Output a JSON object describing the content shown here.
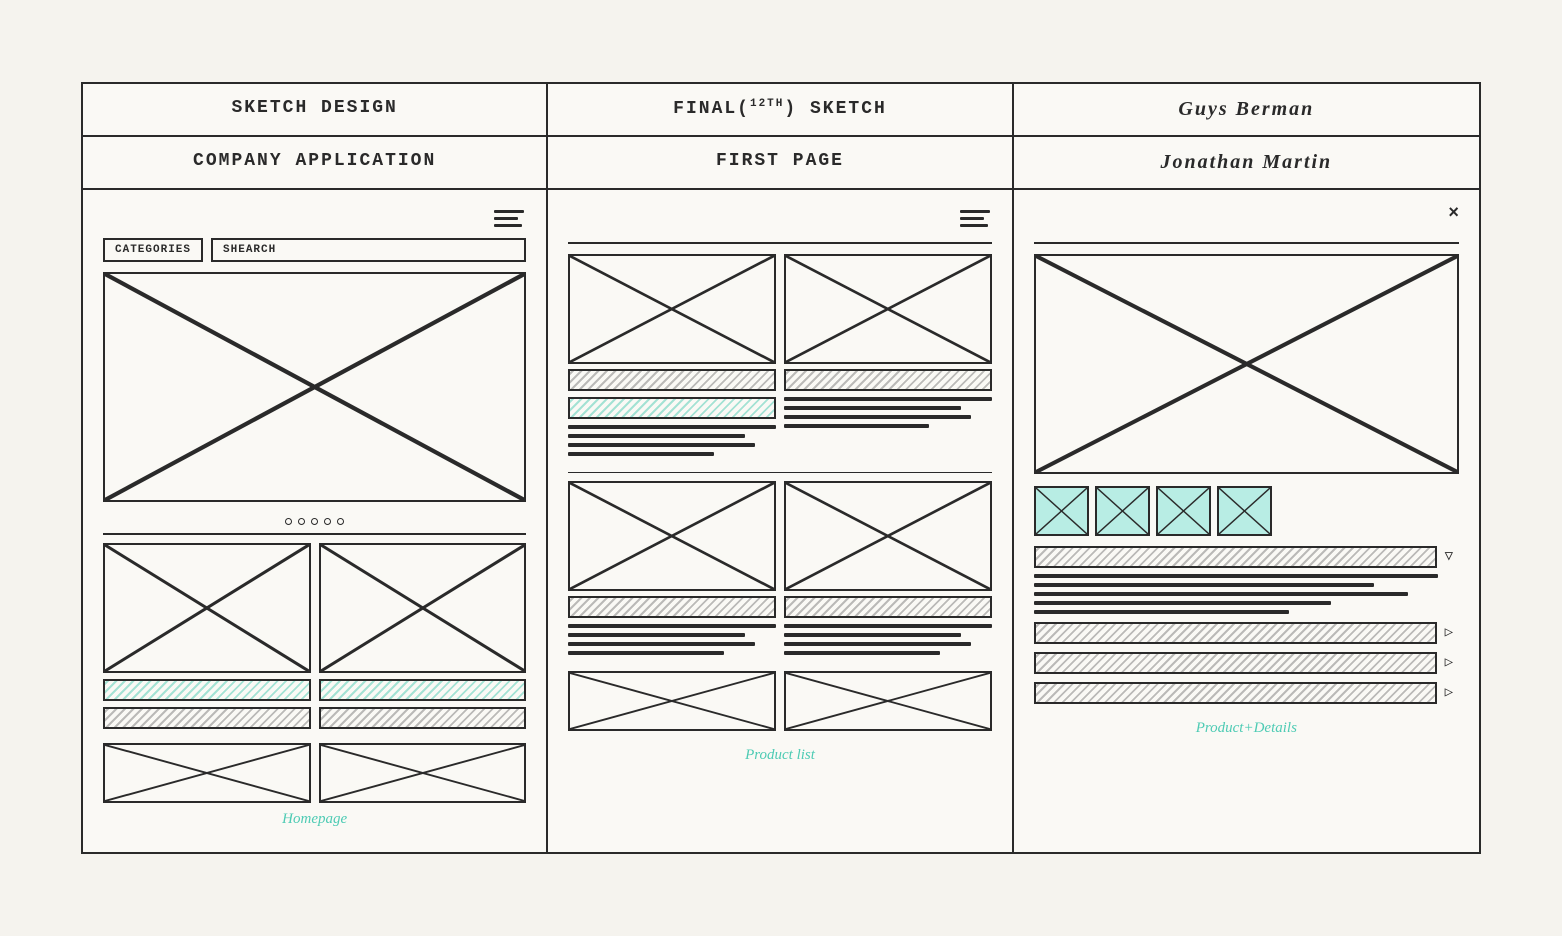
{
  "header": {
    "row1": {
      "col1": "SKETCH DESIGN",
      "col2_pre": "FINAL(",
      "col2_sup": "12th",
      "col2_post": ") SKETCH",
      "col3": "Guys Berman"
    },
    "row2": {
      "col1": "COMPANY APPLICATION",
      "col2": "FIRST PAGE",
      "col3": "Jonathan Martin"
    }
  },
  "panels": [
    {
      "label": "Homepage",
      "type": "homepage"
    },
    {
      "label": "Product list",
      "type": "product-list"
    },
    {
      "label": "Product+Details",
      "type": "product-details"
    }
  ],
  "nav": {
    "categories_label": "CATEGORIES",
    "search_label": "SHEARCH"
  },
  "colors": {
    "green": "#4ecbb4",
    "dark": "#2a2a2a"
  }
}
